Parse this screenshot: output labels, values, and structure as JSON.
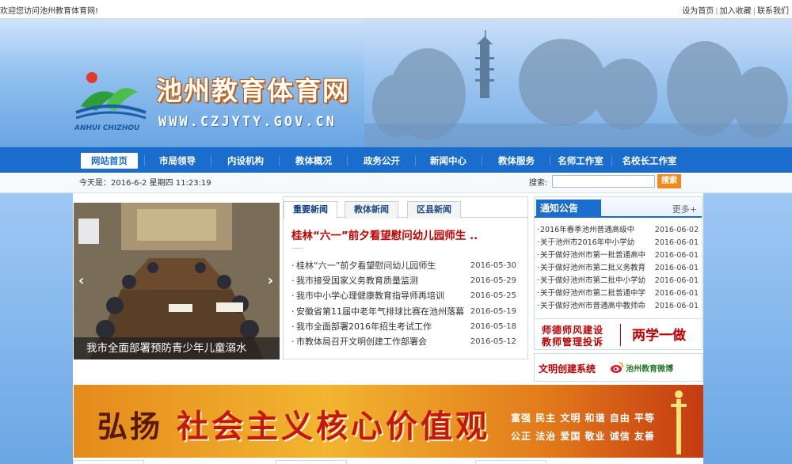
{
  "topbar": {
    "welcome": "欢迎您访问池州教育体育网!",
    "links": [
      "设为首页",
      "加入收藏",
      "联系我们"
    ]
  },
  "header": {
    "site_title": "池州教育体育网",
    "site_url": "WWW.CZJYTY.GOV.CN",
    "logo_text": "ANHUI CHIZHOU"
  },
  "nav": {
    "items": [
      "网站首页",
      "市局领导",
      "内设机构",
      "教体概况",
      "政务公开",
      "新闻中心",
      "教体服务",
      "名师工作室",
      "名校长工作室"
    ],
    "active": "网站首页"
  },
  "datebar": {
    "date_text": "今天是：2016-6-2 星期四 11:23:19",
    "search_label": "搜索:",
    "search_placeholder": "",
    "search_button": "搜索"
  },
  "slider": {
    "caption": "我市全面部署预防青少年儿童溺水",
    "prev_icon": "‹",
    "next_icon": "›"
  },
  "news": {
    "tabs": [
      "重要新闻",
      "教体新闻",
      "区县新闻"
    ],
    "headline": "桂林“六一”前夕看望慰问幼儿园师生 ..",
    "items": [
      {
        "title": "桂林“六一”前夕看望慰问幼儿园师生",
        "date": "2016-05-30"
      },
      {
        "title": "我市接受国家义务教育质量监测",
        "date": "2016-05-29"
      },
      {
        "title": "我市中小学心理健康教育指导师再培训",
        "date": "2016-05-25"
      },
      {
        "title": "安徽省第11届中老年气排球比赛在池州落幕",
        "date": "2016-05-19"
      },
      {
        "title": "我市全面部署2016年招生考试工作",
        "date": "2016-05-18"
      },
      {
        "title": "市教体局召开文明创建工作部署会",
        "date": "2016-05-12"
      }
    ]
  },
  "notice": {
    "title": "通知公告",
    "more": "更多+",
    "items": [
      {
        "title": "2016年春季池州普通高级中",
        "date": "2016-06-02"
      },
      {
        "title": "关于池州市2016年中小学幼",
        "date": "2016-06-01"
      },
      {
        "title": "关于做好池州市第一批普通高中",
        "date": "2016-06-01"
      },
      {
        "title": "关于做好池州市第二批义务教育",
        "date": "2016-06-01"
      },
      {
        "title": "关于做好池州市第二批中小学幼",
        "date": "2016-06-01"
      },
      {
        "title": "关于做好池州市第二批普通中学",
        "date": "2016-06-01"
      },
      {
        "title": "关于做好池州市普通高中教师命",
        "date": "2016-06-01"
      }
    ]
  },
  "promo": {
    "line1": "师德师风建设",
    "line2": "教师管理投诉",
    "right": "两学一做"
  },
  "links2": {
    "a": "文明创建系统",
    "b": "池州教育微博"
  },
  "bigbanner": {
    "w1": "弘扬",
    "w2": "社会主义核心价值观",
    "values1": "富强 民主 文明 和谐 自由 平等",
    "values2": "公正 法治 爱国 敬业 诚信 友善"
  },
  "colors": {
    "nav_blue": "#1a6ccd",
    "accent_orange": "#f08a1f",
    "headline_red": "#c40000"
  }
}
